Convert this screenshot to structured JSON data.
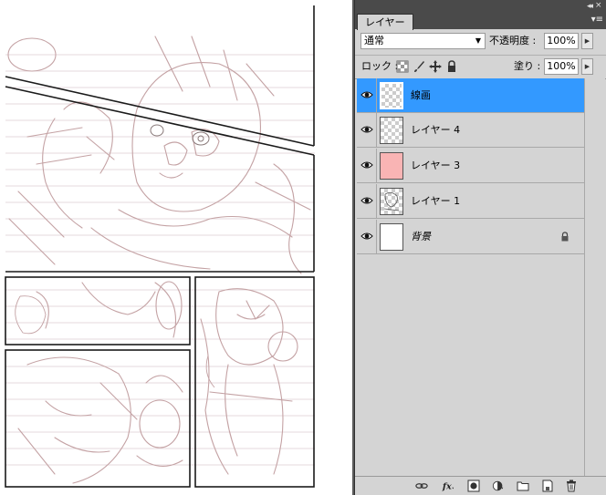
{
  "panel": {
    "tab_label": "レイヤー",
    "blend_mode": "通常",
    "opacity_label": "不透明度 :",
    "opacity_value": "100%",
    "lock_label": "ロック :",
    "fill_label": "塗り :",
    "fill_value": "100%"
  },
  "layers": [
    {
      "name": "線画",
      "selected": true,
      "thumb": "checker"
    },
    {
      "name": "レイヤー 4",
      "selected": false,
      "thumb": "checker"
    },
    {
      "name": "レイヤー 3",
      "selected": false,
      "thumb": "pink"
    },
    {
      "name": "レイヤー 1",
      "selected": false,
      "thumb": "checker"
    },
    {
      "name": "背景",
      "selected": false,
      "thumb": "white",
      "locked": true
    }
  ],
  "footer_icons": [
    "link-layers-icon",
    "layer-style-fx-icon",
    "layer-mask-icon",
    "adjustment-layer-icon",
    "new-group-icon",
    "new-layer-icon",
    "trash-icon"
  ],
  "colors": {
    "selection": "#3399ff",
    "panel_bg": "#d4d4d4",
    "pink_layer": "#f9b4b4",
    "sketch_line": "#b79696"
  }
}
